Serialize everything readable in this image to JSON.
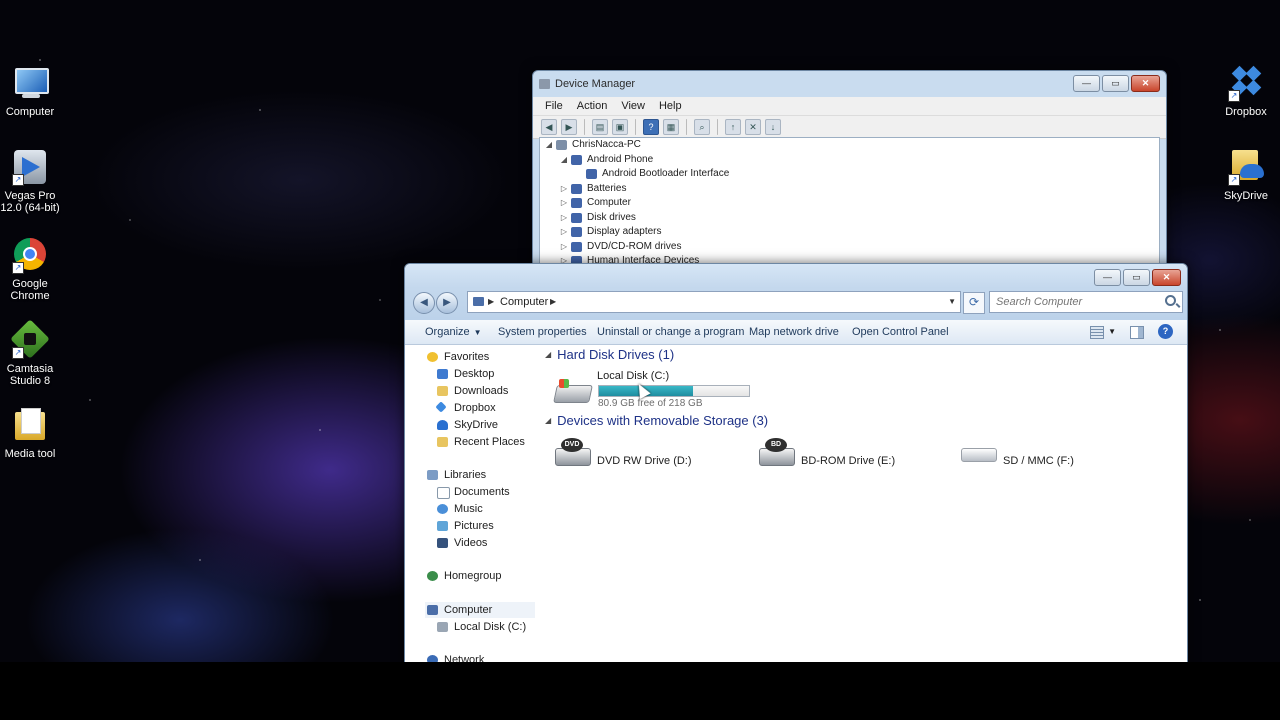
{
  "desktop": {
    "icons": [
      {
        "id": "computer",
        "label": "Computer"
      },
      {
        "id": "vegas",
        "label": "Vegas Pro 12.0 (64-bit)"
      },
      {
        "id": "chrome",
        "label": "Google Chrome"
      },
      {
        "id": "camtasia",
        "label": "Camtasia Studio 8"
      },
      {
        "id": "media",
        "label": "Media tool"
      },
      {
        "id": "dropbox",
        "label": "Dropbox"
      },
      {
        "id": "skydrive",
        "label": "SkyDrive"
      }
    ]
  },
  "device_manager": {
    "title": "Device Manager",
    "menu": [
      "File",
      "Action",
      "View",
      "Help"
    ],
    "tree": [
      {
        "label": "ChrisNacca-PC",
        "level": 0,
        "expanded": true
      },
      {
        "label": "Android Phone",
        "level": 1,
        "expanded": true
      },
      {
        "label": "Android Bootloader Interface",
        "level": 2,
        "expanded": null
      },
      {
        "label": "Batteries",
        "level": 1,
        "expanded": false
      },
      {
        "label": "Computer",
        "level": 1,
        "expanded": false
      },
      {
        "label": "Disk drives",
        "level": 1,
        "expanded": false
      },
      {
        "label": "Display adapters",
        "level": 1,
        "expanded": false
      },
      {
        "label": "DVD/CD-ROM drives",
        "level": 1,
        "expanded": false
      },
      {
        "label": "Human Interface Devices",
        "level": 1,
        "expanded": false
      }
    ]
  },
  "explorer": {
    "breadcrumb": "Computer",
    "search_placeholder": "Search Computer",
    "commands": {
      "organize": "Organize",
      "system_properties": "System properties",
      "uninstall": "Uninstall or change a program",
      "map_drive": "Map network drive",
      "control_panel": "Open Control Panel"
    },
    "nav": {
      "favorites": "Favorites",
      "desktop": "Desktop",
      "downloads": "Downloads",
      "dropbox": "Dropbox",
      "skydrive": "SkyDrive",
      "recent": "Recent Places",
      "libraries": "Libraries",
      "documents": "Documents",
      "music": "Music",
      "pictures": "Pictures",
      "videos": "Videos",
      "homegroup": "Homegroup",
      "computer": "Computer",
      "local_disk": "Local Disk (C:)",
      "network": "Network"
    },
    "groups": {
      "hdd": "Hard Disk Drives (1)",
      "removable": "Devices with Removable Storage (3)"
    },
    "drives": {
      "c": {
        "name": "Local Disk (C:)",
        "free_text": "80.9 GB free of 218 GB",
        "used_fraction": 0.629
      },
      "d": {
        "name": "DVD RW Drive (D:)",
        "badge": "DVD"
      },
      "e": {
        "name": "BD-ROM Drive (E:)",
        "badge": "BD"
      },
      "f": {
        "name": "SD / MMC (F:)"
      }
    }
  }
}
